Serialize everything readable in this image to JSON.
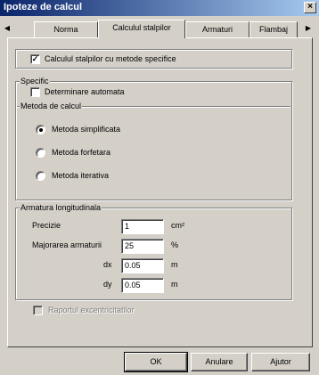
{
  "window": {
    "title": "Ipoteze de calcul",
    "close_glyph": "×"
  },
  "tabs": [
    {
      "label": "Norma"
    },
    {
      "label": "Calculul stalpilor"
    },
    {
      "label": "Armaturi"
    },
    {
      "label": "Flambaj"
    }
  ],
  "nav": {
    "prev_glyph": "◀",
    "next_glyph": "▶"
  },
  "calc_specific": {
    "label": "Calculul stalpilor cu metode specifice",
    "checked": true,
    "mark": "✓"
  },
  "specific": {
    "title": "Specific",
    "auto_label": "Determinare automata",
    "auto_checked": false
  },
  "method": {
    "title": "Metoda de calcul",
    "options": [
      {
        "label": "Metoda simplificata",
        "selected": true
      },
      {
        "label": "Metoda forfetara",
        "selected": false
      },
      {
        "label": "Metoda iterativa",
        "selected": false
      }
    ]
  },
  "armatura": {
    "title": "Armatura longitudinala",
    "precizie": {
      "label": "Precizie",
      "value": "1",
      "unit": "cm²"
    },
    "majorarea": {
      "label": "Majorarea armaturii",
      "value": "25",
      "unit": "%"
    },
    "dx": {
      "label": "dx",
      "value": "0.05",
      "unit": "m"
    },
    "dy": {
      "label": "dy",
      "value": "0.05",
      "unit": "m"
    }
  },
  "raport": {
    "label": "Raportul excentricitatilor",
    "checked": false,
    "disabled": true
  },
  "buttons": {
    "ok": "OK",
    "cancel": "Anulare",
    "help": "Ajutor"
  }
}
